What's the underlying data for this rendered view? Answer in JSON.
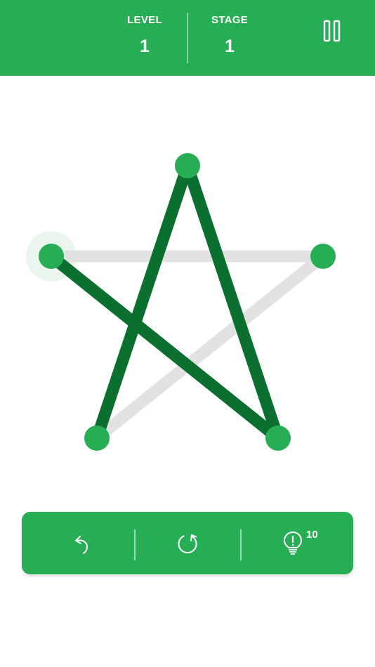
{
  "header": {
    "level_label": "LEVEL",
    "level_value": "1",
    "stage_label": "STAGE",
    "stage_value": "1"
  },
  "controls": {
    "pause_icon": "pause-icon",
    "undo_icon": "undo-icon",
    "restart_icon": "restart-icon",
    "hint_icon": "lightbulb-icon",
    "hint_count": "10"
  },
  "puzzle": {
    "shape": "five-pointed star",
    "vertices": [
      "top",
      "left",
      "right",
      "bottom-left",
      "bottom-right"
    ],
    "edges_drawn": [
      [
        "left",
        "bottom-right"
      ],
      [
        "bottom-right",
        "top"
      ],
      [
        "top",
        "bottom-left"
      ]
    ],
    "edges_remaining": [
      [
        "bottom-left",
        "right"
      ],
      [
        "right",
        "left"
      ]
    ],
    "current_vertex": "left"
  },
  "colors": {
    "brand_green": "#27ae55",
    "drawn_line": "#0b702f",
    "pending_line": "#e2e2e2",
    "node": "#27ae55",
    "current_node_halo": "#e6f4ea",
    "background": "#ffffff"
  }
}
